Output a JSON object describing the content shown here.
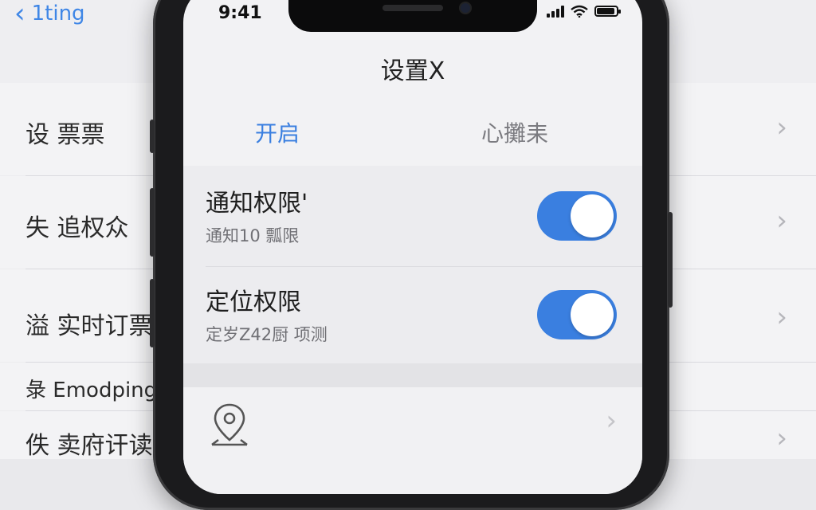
{
  "background": {
    "back_label": "1ting",
    "rows": [
      {
        "label": "设 票票"
      },
      {
        "label": "失 追权众"
      },
      {
        "label": "溢 实时订票"
      },
      {
        "label": " Emodping"
      },
      {
        "label": "佚 卖府讦读"
      }
    ]
  },
  "status_bar": {
    "time": "9:41"
  },
  "screen": {
    "title": "设置X",
    "tabs": [
      {
        "label": "开启",
        "active": true
      },
      {
        "label": "心攤耒",
        "active": false
      }
    ],
    "permissions": [
      {
        "title": "通知权限'",
        "subtitle": "通知10 瓢限",
        "enabled": true
      },
      {
        "title": "定位权限",
        "subtitle": "定岁Z42厨 项测",
        "enabled": true
      }
    ],
    "location_row": {
      "icon": "location-pin-icon"
    }
  },
  "colors": {
    "accent": "#3a7fe0",
    "toggle_on": "#3a7fe0"
  }
}
